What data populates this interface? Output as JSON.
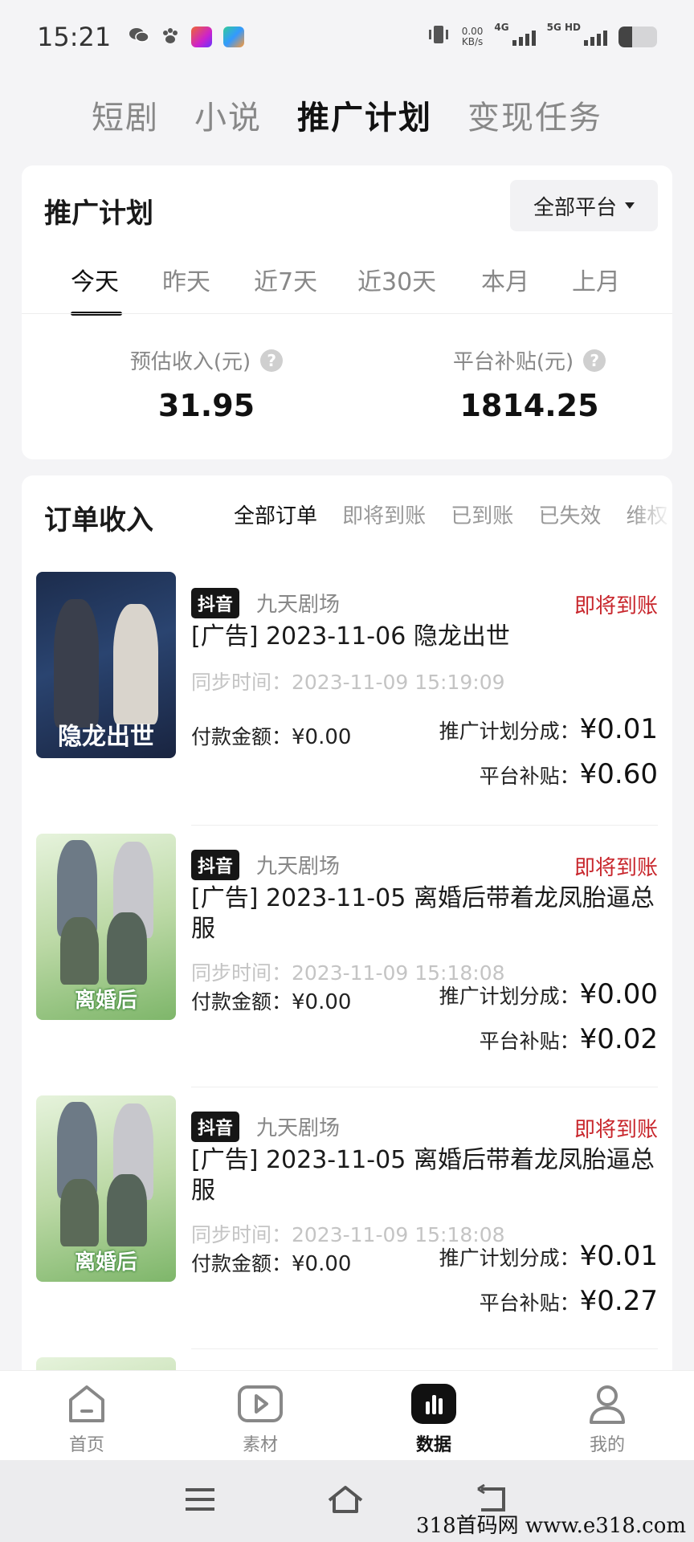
{
  "status_bar": {
    "time": "15:21",
    "net_speed": "0.00",
    "net_unit": "KB/s",
    "signal1": "4G",
    "signal2": "5G HD",
    "battery_level": 0.35
  },
  "top_tabs": [
    {
      "label": "短剧",
      "active": false
    },
    {
      "label": "小说",
      "active": false
    },
    {
      "label": "推广计划",
      "active": true
    },
    {
      "label": "变现任务",
      "active": false
    }
  ],
  "plan": {
    "title": "推广计划",
    "platform_select": "全部平台",
    "ranges": [
      "今天",
      "昨天",
      "近7天",
      "近30天",
      "本月",
      "上月"
    ],
    "active_range": "今天",
    "metrics": [
      {
        "label": "预估收入(元)",
        "value": "31.95",
        "help": "?"
      },
      {
        "label": "平台补贴(元)",
        "value": "1814.25",
        "help": "?"
      }
    ]
  },
  "orders": {
    "title": "订单收入",
    "filters": [
      "全部订单",
      "即将到账",
      "已到账",
      "已失效",
      "维权"
    ],
    "active_filter": "全部订单",
    "items": [
      {
        "poster_text": "隐龙出世",
        "badge": "抖音",
        "source": "九天剧场",
        "status": "即将到账",
        "title": "[广告] 2023-11-06 隐龙出世",
        "sync": "同步时间：2023-11-09 15:19:09",
        "pay_label": "付款金额：",
        "pay_value": "¥0.00",
        "share_label": "推广计划分成：",
        "share_value": "¥0.01",
        "subsidy_label": "平台补贴：",
        "subsidy_value": "¥0.60"
      },
      {
        "poster_text": "离婚后",
        "badge": "抖音",
        "source": "九天剧场",
        "status": "即将到账",
        "title": "[广告] 2023-11-05 离婚后带着龙凤胎逼总服",
        "sync": "同步时间：2023-11-09 15:18:08",
        "pay_label": "付款金额：",
        "pay_value": "¥0.00",
        "share_label": "推广计划分成：",
        "share_value": "¥0.00",
        "subsidy_label": "平台补贴：",
        "subsidy_value": "¥0.02"
      },
      {
        "poster_text": "离婚后",
        "badge": "抖音",
        "source": "九天剧场",
        "status": "即将到账",
        "title": "[广告] 2023-11-05 离婚后带着龙凤胎逼总服",
        "sync": "同步时间：2023-11-09 15:18:08",
        "pay_label": "付款金额：",
        "pay_value": "¥0.00",
        "share_label": "推广计划分成：",
        "share_value": "¥0.01",
        "subsidy_label": "平台补贴：",
        "subsidy_value": "¥0.27"
      }
    ]
  },
  "bottom_nav": [
    {
      "label": "首页",
      "icon": "home-icon",
      "active": false
    },
    {
      "label": "素材",
      "icon": "play-icon",
      "active": false
    },
    {
      "label": "数据",
      "icon": "chart-icon",
      "active": true
    },
    {
      "label": "我的",
      "icon": "user-icon",
      "active": false
    }
  ],
  "system_nav": [
    "menu-icon",
    "home-icon",
    "back-icon"
  ],
  "watermark": "318首码网 www.e318.com"
}
